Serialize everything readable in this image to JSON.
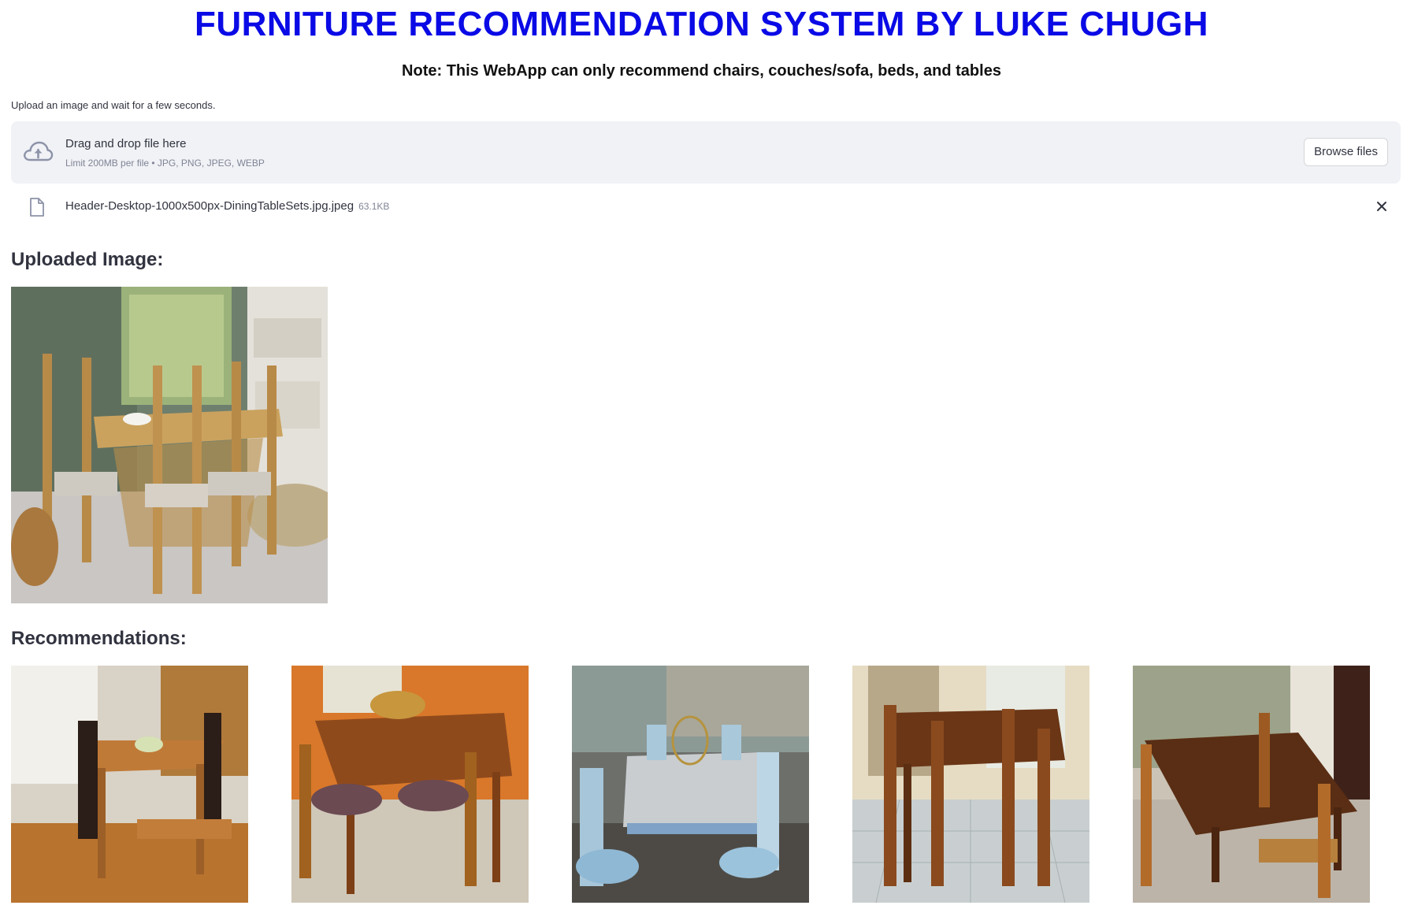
{
  "header": {
    "title": "FURNITURE RECOMMENDATION SYSTEM BY LUKE CHUGH",
    "note": "Note: This WebApp can only recommend chairs, couches/sofa, beds, and tables"
  },
  "uploader": {
    "label": "Upload an image and wait for a few seconds.",
    "drop_title": "Drag and drop file here",
    "limit_text": "Limit 200MB per file • JPG, PNG, JPEG, WEBP",
    "browse_label": "Browse files",
    "icon": "cloud-upload-icon"
  },
  "uploaded_file": {
    "name": "Header-Desktop-1000x500px-DiningTableSets.jpg.jpeg",
    "size": "63.1KB",
    "icon": "file-icon",
    "remove_icon": "close-icon"
  },
  "uploaded_section": {
    "heading": "Uploaded Image:"
  },
  "recommendations_section": {
    "heading": "Recommendations:",
    "count": 5
  },
  "colors": {
    "title": "#0a0ae6",
    "dropzone_bg": "#f0f2f6",
    "muted_text": "#808495",
    "body_text": "#31333f"
  }
}
